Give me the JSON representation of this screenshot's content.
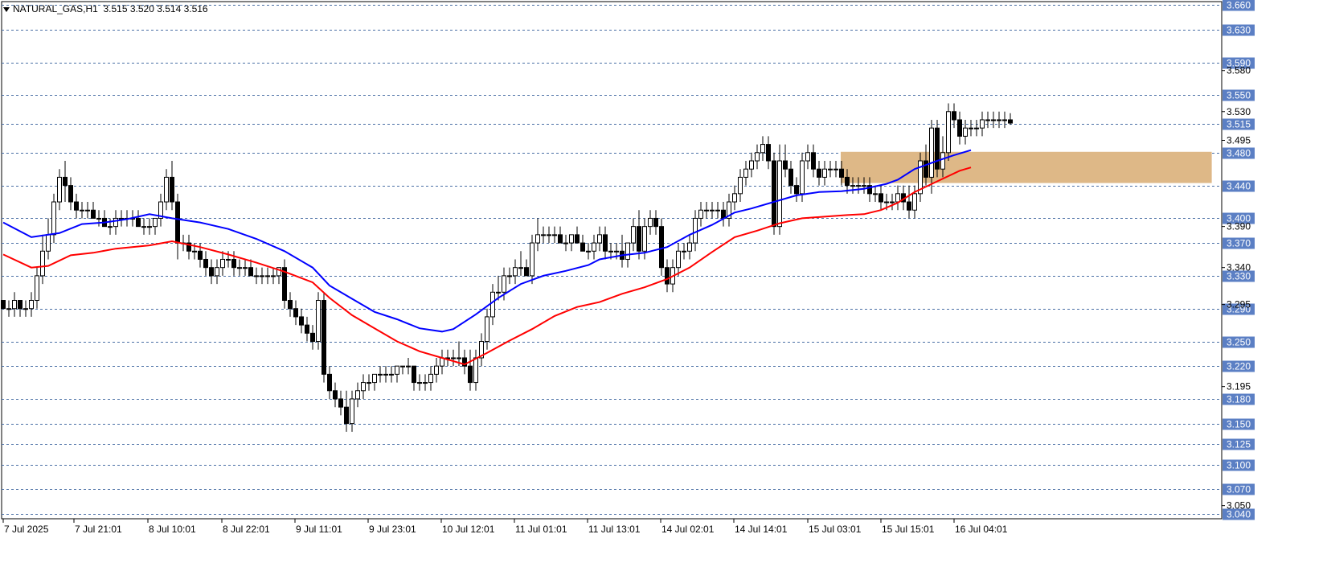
{
  "header": {
    "symbol": "NATURAL_GAS,H1",
    "ohlc": "3.515 3.520 3.514 3.516"
  },
  "colors": {
    "ema_fast": "#0000ff",
    "ema_slow": "#ff0000",
    "zone": "#deb887",
    "grid": "#4a6fa5",
    "tag_bg": "#5b7fc4",
    "candle_bull": "#ffffff",
    "candle_bear": "#000000"
  },
  "chart_data": {
    "type": "candlestick",
    "ylim": [
      3.034,
      3.664
    ],
    "price_grid": [
      "3.660",
      "3.630",
      "3.590",
      "3.550",
      "3.515",
      "3.480",
      "3.440",
      "3.400",
      "3.370",
      "3.330",
      "3.290",
      "3.250",
      "3.220",
      "3.180",
      "3.150",
      "3.125",
      "3.100",
      "3.070",
      "3.040"
    ],
    "scale_labels": [
      "3.580",
      "3.530",
      "3.495",
      "3.390",
      "3.340",
      "3.295",
      "3.195",
      "3.050"
    ],
    "time_labels": [
      "7 Jul 2025",
      "7 Jul 21:01",
      "8 Jul 10:01",
      "8 Jul 22:01",
      "9 Jul 11:01",
      "9 Jul 23:01",
      "10 Jul 12:01",
      "11 Jul 01:01",
      "11 Jul 13:01",
      "14 Jul 02:01",
      "14 Jul 14:01",
      "15 Jul 03:01",
      "15 Jul 15:01",
      "16 Jul 04:01"
    ],
    "zone": {
      "from_candle": 0.83,
      "to_candle": 1.2,
      "low": 3.443,
      "high": 3.481
    },
    "ema_fast": [
      [
        0,
        3.395
      ],
      [
        5,
        3.377
      ],
      [
        10,
        3.382
      ],
      [
        14,
        3.393
      ],
      [
        18,
        3.395
      ],
      [
        22,
        3.399
      ],
      [
        26,
        3.405
      ],
      [
        30,
        3.4
      ],
      [
        35,
        3.395
      ],
      [
        40,
        3.387
      ],
      [
        45,
        3.375
      ],
      [
        50,
        3.36
      ],
      [
        55,
        3.34
      ],
      [
        58,
        3.318
      ],
      [
        62,
        3.302
      ],
      [
        66,
        3.286
      ],
      [
        70,
        3.277
      ],
      [
        74,
        3.266
      ],
      [
        78,
        3.262
      ],
      [
        80,
        3.265
      ],
      [
        84,
        3.283
      ],
      [
        88,
        3.303
      ],
      [
        92,
        3.32
      ],
      [
        96,
        3.33
      ],
      [
        100,
        3.336
      ],
      [
        104,
        3.343
      ],
      [
        106,
        3.35
      ],
      [
        110,
        3.355
      ],
      [
        114,
        3.358
      ],
      [
        118,
        3.365
      ],
      [
        122,
        3.38
      ],
      [
        126,
        3.392
      ],
      [
        130,
        3.407
      ],
      [
        133,
        3.412
      ],
      [
        137,
        3.42
      ],
      [
        141,
        3.428
      ],
      [
        145,
        3.432
      ],
      [
        149,
        3.433
      ],
      [
        153,
        3.436
      ],
      [
        157,
        3.442
      ],
      [
        159,
        3.447
      ],
      [
        162,
        3.46
      ],
      [
        166,
        3.47
      ],
      [
        169,
        3.477
      ],
      [
        172,
        3.483
      ]
    ],
    "ema_slow": [
      [
        0,
        3.356
      ],
      [
        5,
        3.34
      ],
      [
        8,
        3.342
      ],
      [
        12,
        3.355
      ],
      [
        16,
        3.358
      ],
      [
        20,
        3.363
      ],
      [
        26,
        3.367
      ],
      [
        30,
        3.372
      ],
      [
        35,
        3.365
      ],
      [
        40,
        3.356
      ],
      [
        45,
        3.346
      ],
      [
        50,
        3.335
      ],
      [
        55,
        3.322
      ],
      [
        58,
        3.303
      ],
      [
        62,
        3.282
      ],
      [
        66,
        3.266
      ],
      [
        70,
        3.25
      ],
      [
        74,
        3.238
      ],
      [
        78,
        3.23
      ],
      [
        82,
        3.222
      ],
      [
        86,
        3.236
      ],
      [
        90,
        3.251
      ],
      [
        94,
        3.265
      ],
      [
        98,
        3.281
      ],
      [
        102,
        3.292
      ],
      [
        106,
        3.298
      ],
      [
        110,
        3.308
      ],
      [
        114,
        3.316
      ],
      [
        118,
        3.326
      ],
      [
        122,
        3.34
      ],
      [
        126,
        3.359
      ],
      [
        130,
        3.377
      ],
      [
        134,
        3.385
      ],
      [
        138,
        3.394
      ],
      [
        142,
        3.4
      ],
      [
        146,
        3.402
      ],
      [
        150,
        3.404
      ],
      [
        153,
        3.405
      ],
      [
        156,
        3.41
      ],
      [
        159,
        3.419
      ],
      [
        162,
        3.432
      ],
      [
        166,
        3.445
      ],
      [
        170,
        3.458
      ],
      [
        172,
        3.462
      ]
    ],
    "candles": [
      [
        3.3,
        3.3,
        3.29,
        3.29
      ],
      [
        3.29,
        3.3,
        3.28,
        3.29
      ],
      [
        3.29,
        3.31,
        3.28,
        3.3
      ],
      [
        3.3,
        3.3,
        3.28,
        3.29
      ],
      [
        3.29,
        3.3,
        3.28,
        3.29
      ],
      [
        3.29,
        3.31,
        3.28,
        3.3
      ],
      [
        3.3,
        3.34,
        3.29,
        3.33
      ],
      [
        3.33,
        3.38,
        3.32,
        3.36
      ],
      [
        3.36,
        3.4,
        3.35,
        3.38
      ],
      [
        3.38,
        3.43,
        3.37,
        3.42
      ],
      [
        3.42,
        3.46,
        3.41,
        3.45
      ],
      [
        3.45,
        3.47,
        3.42,
        3.44
      ],
      [
        3.44,
        3.45,
        3.41,
        3.42
      ],
      [
        3.42,
        3.43,
        3.4,
        3.41
      ],
      [
        3.41,
        3.42,
        3.4,
        3.41
      ],
      [
        3.41,
        3.42,
        3.4,
        3.41
      ],
      [
        3.41,
        3.42,
        3.4,
        3.4
      ],
      [
        3.4,
        3.41,
        3.39,
        3.4
      ],
      [
        3.4,
        3.41,
        3.39,
        3.39
      ],
      [
        3.39,
        3.4,
        3.38,
        3.39
      ],
      [
        3.39,
        3.41,
        3.38,
        3.4
      ],
      [
        3.4,
        3.41,
        3.39,
        3.4
      ],
      [
        3.4,
        3.41,
        3.39,
        3.4
      ],
      [
        3.4,
        3.41,
        3.39,
        3.4
      ],
      [
        3.4,
        3.41,
        3.39,
        3.39
      ],
      [
        3.39,
        3.4,
        3.38,
        3.39
      ],
      [
        3.39,
        3.4,
        3.38,
        3.39
      ],
      [
        3.39,
        3.4,
        3.38,
        3.4
      ],
      [
        3.4,
        3.43,
        3.39,
        3.42
      ],
      [
        3.42,
        3.46,
        3.41,
        3.45
      ],
      [
        3.45,
        3.47,
        3.41,
        3.42
      ],
      [
        3.42,
        3.43,
        3.35,
        3.37
      ],
      [
        3.37,
        3.38,
        3.36,
        3.37
      ],
      [
        3.37,
        3.38,
        3.35,
        3.36
      ],
      [
        3.36,
        3.37,
        3.35,
        3.36
      ],
      [
        3.36,
        3.37,
        3.34,
        3.35
      ],
      [
        3.35,
        3.36,
        3.33,
        3.34
      ],
      [
        3.34,
        3.35,
        3.32,
        3.33
      ],
      [
        3.33,
        3.35,
        3.32,
        3.34
      ],
      [
        3.34,
        3.36,
        3.33,
        3.35
      ],
      [
        3.35,
        3.36,
        3.34,
        3.35
      ],
      [
        3.35,
        3.36,
        3.33,
        3.34
      ],
      [
        3.34,
        3.35,
        3.33,
        3.34
      ],
      [
        3.34,
        3.35,
        3.33,
        3.34
      ],
      [
        3.34,
        3.35,
        3.33,
        3.33
      ],
      [
        3.33,
        3.34,
        3.32,
        3.33
      ],
      [
        3.33,
        3.34,
        3.32,
        3.33
      ],
      [
        3.33,
        3.34,
        3.32,
        3.33
      ],
      [
        3.33,
        3.34,
        3.32,
        3.33
      ],
      [
        3.33,
        3.34,
        3.32,
        3.34
      ],
      [
        3.34,
        3.35,
        3.29,
        3.3
      ],
      [
        3.3,
        3.31,
        3.28,
        3.29
      ],
      [
        3.29,
        3.3,
        3.27,
        3.28
      ],
      [
        3.28,
        3.29,
        3.26,
        3.27
      ],
      [
        3.27,
        3.28,
        3.25,
        3.26
      ],
      [
        3.26,
        3.27,
        3.24,
        3.25
      ],
      [
        3.25,
        3.31,
        3.24,
        3.3
      ],
      [
        3.3,
        3.31,
        3.2,
        3.21
      ],
      [
        3.21,
        3.22,
        3.18,
        3.19
      ],
      [
        3.19,
        3.2,
        3.17,
        3.18
      ],
      [
        3.18,
        3.19,
        3.16,
        3.17
      ],
      [
        3.17,
        3.19,
        3.14,
        3.15
      ],
      [
        3.15,
        3.19,
        3.14,
        3.18
      ],
      [
        3.18,
        3.2,
        3.17,
        3.19
      ],
      [
        3.19,
        3.21,
        3.18,
        3.2
      ],
      [
        3.2,
        3.21,
        3.19,
        3.2
      ],
      [
        3.2,
        3.21,
        3.19,
        3.21
      ],
      [
        3.21,
        3.22,
        3.2,
        3.21
      ],
      [
        3.21,
        3.22,
        3.2,
        3.21
      ],
      [
        3.21,
        3.22,
        3.2,
        3.21
      ],
      [
        3.21,
        3.22,
        3.2,
        3.22
      ],
      [
        3.22,
        3.22,
        3.21,
        3.22
      ],
      [
        3.22,
        3.23,
        3.21,
        3.22
      ],
      [
        3.22,
        3.22,
        3.19,
        3.2
      ],
      [
        3.2,
        3.21,
        3.19,
        3.2
      ],
      [
        3.2,
        3.21,
        3.19,
        3.2
      ],
      [
        3.2,
        3.22,
        3.19,
        3.21
      ],
      [
        3.21,
        3.23,
        3.2,
        3.22
      ],
      [
        3.22,
        3.24,
        3.21,
        3.23
      ],
      [
        3.23,
        3.24,
        3.22,
        3.23
      ],
      [
        3.23,
        3.24,
        3.22,
        3.23
      ],
      [
        3.23,
        3.25,
        3.22,
        3.23
      ],
      [
        3.23,
        3.24,
        3.21,
        3.22
      ],
      [
        3.22,
        3.24,
        3.19,
        3.2
      ],
      [
        3.2,
        3.24,
        3.19,
        3.23
      ],
      [
        3.23,
        3.26,
        3.22,
        3.25
      ],
      [
        3.25,
        3.29,
        3.24,
        3.28
      ],
      [
        3.28,
        3.32,
        3.27,
        3.31
      ],
      [
        3.31,
        3.33,
        3.3,
        3.31
      ],
      [
        3.31,
        3.34,
        3.3,
        3.33
      ],
      [
        3.33,
        3.34,
        3.32,
        3.33
      ],
      [
        3.33,
        3.35,
        3.32,
        3.34
      ],
      [
        3.34,
        3.36,
        3.33,
        3.34
      ],
      [
        3.34,
        3.35,
        3.33,
        3.33
      ],
      [
        3.33,
        3.38,
        3.32,
        3.37
      ],
      [
        3.37,
        3.4,
        3.36,
        3.38
      ],
      [
        3.38,
        3.39,
        3.37,
        3.38
      ],
      [
        3.38,
        3.39,
        3.37,
        3.38
      ],
      [
        3.38,
        3.39,
        3.37,
        3.38
      ],
      [
        3.38,
        3.39,
        3.37,
        3.37
      ],
      [
        3.37,
        3.38,
        3.36,
        3.37
      ],
      [
        3.37,
        3.38,
        3.36,
        3.38
      ],
      [
        3.38,
        3.39,
        3.37,
        3.37
      ],
      [
        3.37,
        3.38,
        3.36,
        3.36
      ],
      [
        3.36,
        3.37,
        3.35,
        3.36
      ],
      [
        3.36,
        3.38,
        3.35,
        3.37
      ],
      [
        3.37,
        3.39,
        3.36,
        3.38
      ],
      [
        3.38,
        3.39,
        3.35,
        3.36
      ],
      [
        3.36,
        3.37,
        3.35,
        3.36
      ],
      [
        3.36,
        3.37,
        3.35,
        3.36
      ],
      [
        3.36,
        3.38,
        3.34,
        3.35
      ],
      [
        3.35,
        3.37,
        3.34,
        3.37
      ],
      [
        3.37,
        3.4,
        3.36,
        3.39
      ],
      [
        3.39,
        3.41,
        3.35,
        3.36
      ],
      [
        3.36,
        3.4,
        3.35,
        3.39
      ],
      [
        3.39,
        3.41,
        3.38,
        3.4
      ],
      [
        3.4,
        3.41,
        3.38,
        3.39
      ],
      [
        3.39,
        3.4,
        3.33,
        3.34
      ],
      [
        3.34,
        3.35,
        3.31,
        3.32
      ],
      [
        3.32,
        3.35,
        3.31,
        3.34
      ],
      [
        3.34,
        3.37,
        3.33,
        3.36
      ],
      [
        3.36,
        3.37,
        3.35,
        3.36
      ],
      [
        3.36,
        3.38,
        3.35,
        3.37
      ],
      [
        3.37,
        3.41,
        3.36,
        3.4
      ],
      [
        3.4,
        3.42,
        3.39,
        3.41
      ],
      [
        3.41,
        3.42,
        3.4,
        3.41
      ],
      [
        3.41,
        3.42,
        3.4,
        3.41
      ],
      [
        3.41,
        3.42,
        3.4,
        3.41
      ],
      [
        3.41,
        3.42,
        3.39,
        3.4
      ],
      [
        3.4,
        3.43,
        3.39,
        3.42
      ],
      [
        3.42,
        3.44,
        3.41,
        3.43
      ],
      [
        3.43,
        3.46,
        3.42,
        3.45
      ],
      [
        3.45,
        3.47,
        3.44,
        3.46
      ],
      [
        3.46,
        3.48,
        3.45,
        3.47
      ],
      [
        3.47,
        3.49,
        3.46,
        3.48
      ],
      [
        3.48,
        3.5,
        3.47,
        3.49
      ],
      [
        3.49,
        3.5,
        3.46,
        3.47
      ],
      [
        3.47,
        3.48,
        3.38,
        3.39
      ],
      [
        3.39,
        3.49,
        3.38,
        3.47
      ],
      [
        3.47,
        3.49,
        3.45,
        3.46
      ],
      [
        3.46,
        3.47,
        3.43,
        3.44
      ],
      [
        3.44,
        3.45,
        3.42,
        3.43
      ],
      [
        3.43,
        3.48,
        3.42,
        3.47
      ],
      [
        3.47,
        3.49,
        3.46,
        3.48
      ],
      [
        3.48,
        3.49,
        3.45,
        3.46
      ],
      [
        3.46,
        3.47,
        3.44,
        3.45
      ],
      [
        3.45,
        3.47,
        3.44,
        3.46
      ],
      [
        3.46,
        3.47,
        3.45,
        3.46
      ],
      [
        3.46,
        3.47,
        3.45,
        3.46
      ],
      [
        3.46,
        3.47,
        3.44,
        3.45
      ],
      [
        3.45,
        3.46,
        3.43,
        3.44
      ],
      [
        3.44,
        3.45,
        3.43,
        3.44
      ],
      [
        3.44,
        3.45,
        3.43,
        3.44
      ],
      [
        3.44,
        3.45,
        3.43,
        3.44
      ],
      [
        3.44,
        3.45,
        3.42,
        3.43
      ],
      [
        3.43,
        3.44,
        3.42,
        3.43
      ],
      [
        3.43,
        3.44,
        3.41,
        3.42
      ],
      [
        3.42,
        3.43,
        3.41,
        3.42
      ],
      [
        3.42,
        3.43,
        3.41,
        3.42
      ],
      [
        3.42,
        3.44,
        3.41,
        3.43
      ],
      [
        3.43,
        3.44,
        3.41,
        3.42
      ],
      [
        3.42,
        3.44,
        3.4,
        3.41
      ],
      [
        3.41,
        3.44,
        3.4,
        3.43
      ],
      [
        3.43,
        3.48,
        3.42,
        3.47
      ],
      [
        3.47,
        3.49,
        3.44,
        3.45
      ],
      [
        3.45,
        3.52,
        3.43,
        3.51
      ],
      [
        3.51,
        3.52,
        3.45,
        3.46
      ],
      [
        3.46,
        3.5,
        3.45,
        3.48
      ],
      [
        3.48,
        3.54,
        3.47,
        3.53
      ],
      [
        3.53,
        3.54,
        3.51,
        3.52
      ],
      [
        3.52,
        3.53,
        3.49,
        3.5
      ],
      [
        3.5,
        3.52,
        3.49,
        3.51
      ],
      [
        3.51,
        3.52,
        3.5,
        3.51
      ],
      [
        3.51,
        3.52,
        3.5,
        3.51
      ],
      [
        3.51,
        3.53,
        3.5,
        3.52
      ],
      [
        3.52,
        3.53,
        3.51,
        3.52
      ],
      [
        3.52,
        3.53,
        3.51,
        3.52
      ],
      [
        3.52,
        3.53,
        3.51,
        3.52
      ],
      [
        3.52,
        3.53,
        3.51,
        3.52
      ],
      [
        3.52,
        3.528,
        3.514,
        3.516
      ]
    ]
  }
}
